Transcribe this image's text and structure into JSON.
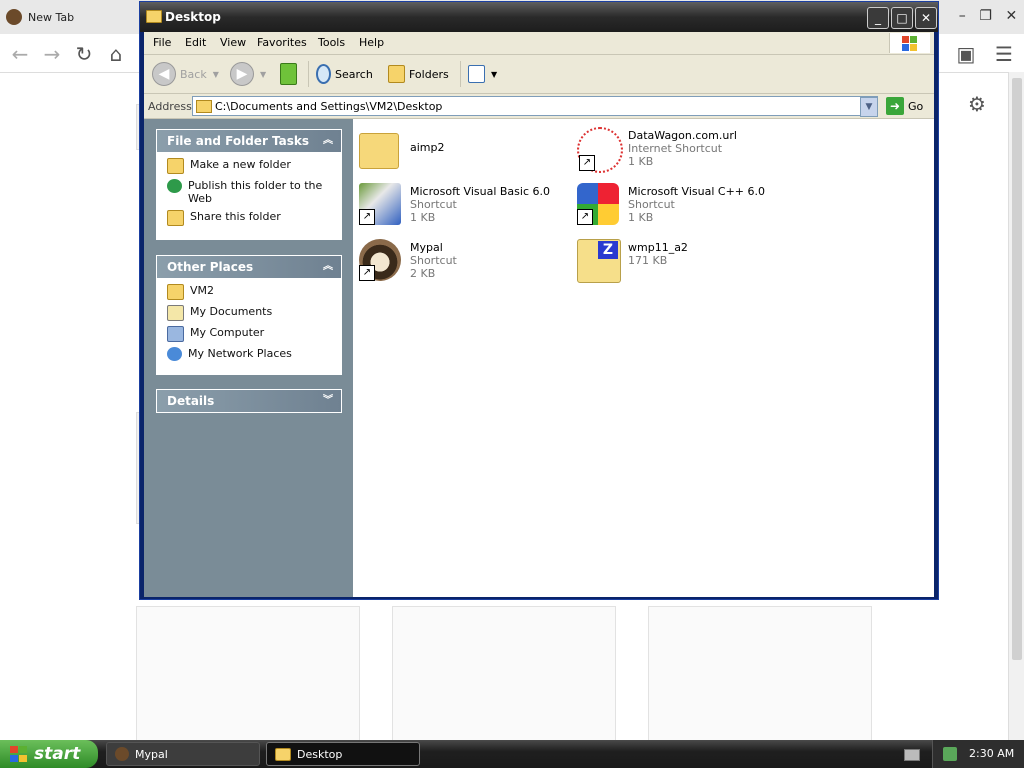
{
  "browser": {
    "tab_title": "New Tab",
    "nav_back": "←",
    "nav_forward": "→",
    "nav_reload": "↻",
    "nav_home": "⌂",
    "settings_icon": "⚙",
    "menu_icon": "☰",
    "win_minimize": "–",
    "win_restore": "❐",
    "win_close": "✕"
  },
  "explorer": {
    "title": "Desktop",
    "titlebar_buttons": {
      "minimize": "_",
      "maximize": "□",
      "close": "✕"
    },
    "menu": [
      "File",
      "Edit",
      "View",
      "Favorites",
      "Tools",
      "Help"
    ],
    "toolbar": {
      "back_label": "Back",
      "search_label": "Search",
      "folders_label": "Folders"
    },
    "address": {
      "label": "Address",
      "value": "C:\\Documents and Settings\\VM2\\Desktop",
      "go_label": "Go"
    },
    "task_panels": [
      {
        "title": "File and Folder Tasks",
        "chevron": "︽",
        "items": [
          "Make a new folder",
          "Publish this folder to the Web",
          "Share this folder"
        ]
      },
      {
        "title": "Other Places",
        "chevron": "︽",
        "items": [
          "VM2",
          "My Documents",
          "My Computer",
          "My Network Places"
        ]
      },
      {
        "title": "Details",
        "chevron": "︾",
        "items": []
      }
    ],
    "files": [
      {
        "name": "aimp2",
        "type": "",
        "size": ""
      },
      {
        "name": "DataWagon.com.url",
        "type": "Internet Shortcut",
        "size": "1 KB"
      },
      {
        "name": "Microsoft Visual Basic 6.0",
        "type": "Shortcut",
        "size": "1 KB"
      },
      {
        "name": "Microsoft Visual C++ 6.0",
        "type": "Shortcut",
        "size": "1 KB"
      },
      {
        "name": "Mypal",
        "type": "Shortcut",
        "size": "2 KB"
      },
      {
        "name": "wmp11_a2",
        "type": "",
        "size": "171 KB"
      }
    ]
  },
  "taskbar": {
    "start_label": "start",
    "tasks": [
      "Mypal",
      "Desktop"
    ],
    "clock": "2:30 AM"
  },
  "colors": {
    "explorer_title_bg": "#2a2a2a",
    "left_pane_bg": "#7a8c97",
    "panel_header": "#8b9eab",
    "start_button": "#3c9a30",
    "taskbar_bg": "#1f1f1f"
  }
}
